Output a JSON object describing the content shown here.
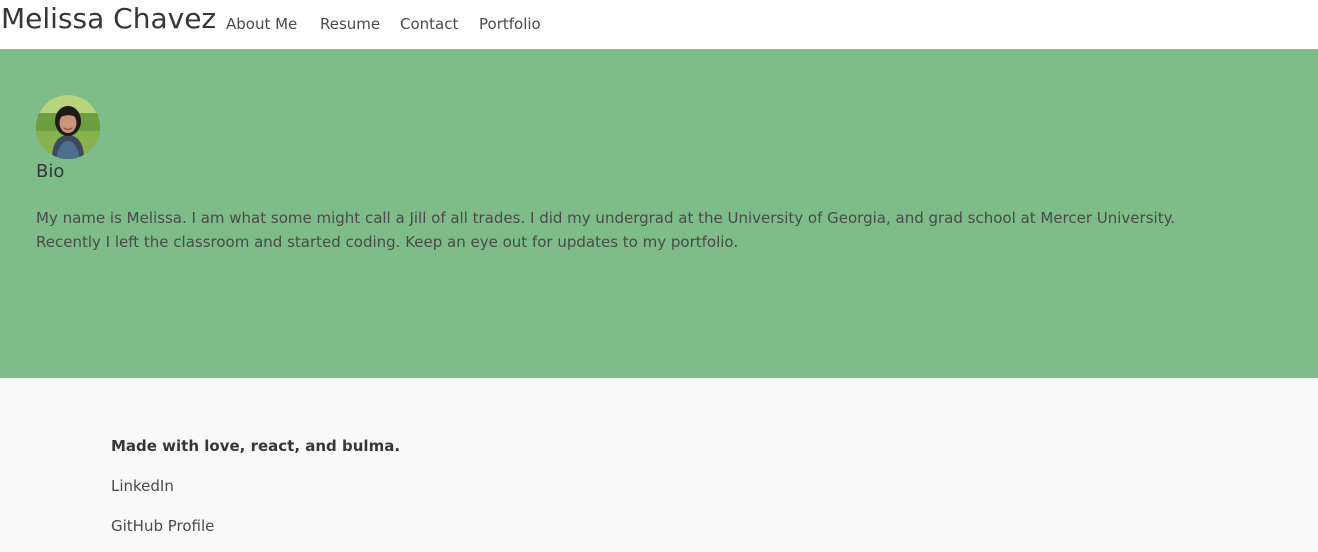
{
  "brand": "Melissa Chavez",
  "nav": {
    "items": [
      {
        "label": "About Me"
      },
      {
        "label": "Resume"
      },
      {
        "label": "Contact"
      },
      {
        "label": "Portfolio"
      }
    ]
  },
  "hero": {
    "title": "Bio",
    "text": "My name is Melissa. I am what some might call a Jill of all trades. I did my undergrad at the University of Georgia, and grad school at Mercer University. Recently I left the classroom and started coding. Keep an eye out for updates to my portfolio."
  },
  "footer": {
    "made_with": "Made with love, react, and bulma.",
    "links": [
      {
        "label": "LinkedIn"
      },
      {
        "label": "GitHub Profile"
      }
    ]
  },
  "colors": {
    "hero_bg": "#7ebd89",
    "navbar_bg": "#ffffff",
    "footer_bg": "#f9f9f9",
    "text": "#4a4a4a",
    "heading": "#363636"
  }
}
